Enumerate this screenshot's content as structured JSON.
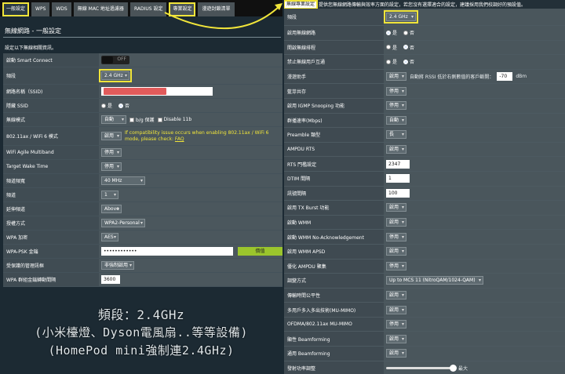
{
  "left": {
    "tabs": [
      "一般設定",
      "WPS",
      "WDS",
      "無線 MAC 地址過濾器",
      "RADIUS 設定",
      "專業設定",
      "漫遊封鎖清單"
    ],
    "title": "無線網路 - 一般設定",
    "description": "設定以下無線相關資訊。",
    "rows": {
      "smart_connect": {
        "label": "啟動 Smart Connect",
        "toggle": "OFF"
      },
      "band": {
        "label": "頻段",
        "value": "2.4 GHz"
      },
      "ssid": {
        "label": "網路名稱（SSID)"
      },
      "hide_ssid": {
        "label": "隱藏 SSID",
        "yes": "是",
        "no": "否"
      },
      "wireless_mode": {
        "label": "無線模式",
        "value": "自動",
        "bg_protect": "b/g 保護",
        "disable11b": "Disable 11b"
      },
      "ax_mode": {
        "label": "802.11ax / WiFi 6 模式",
        "value": "啟用",
        "warn": "If compatibility issue occurs when enabling 802.11ax / WiFi 6 mode, please check:",
        "faq": "FAQ"
      },
      "multiband": {
        "label": "WiFi Agile Multiband",
        "value": "停用"
      },
      "twt": {
        "label": "Target Wake Time",
        "value": "停用"
      },
      "bandwidth": {
        "label": "頻道頻寬",
        "value": "40 MHz"
      },
      "channel": {
        "label": "頻道",
        "value": "1"
      },
      "ext_channel": {
        "label": "延伸頻道",
        "value": "Above"
      },
      "auth": {
        "label": "授權方式",
        "value": "WPA2-Personal"
      },
      "wpa_enc": {
        "label": "WPA 加密",
        "value": "AES"
      },
      "psk": {
        "label": "WPA-PSK 金鑰",
        "value": "••••••••••••",
        "show": "價值"
      },
      "pmf": {
        "label": "受保護的管理訊框",
        "value": "非強制啟用"
      },
      "rekey": {
        "label": "WPA 群組金鑰轉動間隔",
        "value": "3600"
      }
    },
    "caption": {
      "line1": "頻段：2.4GHz",
      "line2": "(小米檯燈、Dyson電風扇..等等設備)",
      "line3": "(HomePod mini強制連2.4GHz)"
    }
  },
  "right": {
    "header_tab": "無線專業設定",
    "header_desc": "提供您無線網路傳輸與效率方面的設定，若您沒有選擇適合的設定，建議採用我們校調好的預設值。",
    "rows": [
      {
        "label": "頻段",
        "type": "select",
        "value": "2.4 GHz",
        "hl": true
      },
      {
        "label": "啟用無線網路",
        "type": "radio",
        "yes": "是",
        "no": "否",
        "on": "yes"
      },
      {
        "label": "開啟無線排程",
        "type": "radio",
        "yes": "是",
        "no": "否",
        "on": "no"
      },
      {
        "label": "禁止無線用戶互通",
        "type": "radio",
        "yes": "是",
        "no": "否",
        "on": "no"
      },
      {
        "label": "漫遊助手",
        "type": "roam",
        "value": "啟用",
        "text": "自動將 RSSI 低於右側數值的客戶斷開：",
        "rssi": "-70",
        "unit": "dBm"
      },
      {
        "label": "藍芽共存",
        "type": "select",
        "value": "停用"
      },
      {
        "label": "啟用 IGMP Snooping 功能",
        "type": "select",
        "value": "停用"
      },
      {
        "label": "群播速率(Mbps)",
        "type": "select",
        "value": "自動"
      },
      {
        "label": "Preamble 類型",
        "type": "select",
        "value": "長"
      },
      {
        "label": "AMPDU RTS",
        "type": "select",
        "value": "啟用"
      },
      {
        "label": "RTS 門檻設定",
        "type": "text",
        "value": "2347"
      },
      {
        "label": "DTIM 間隔",
        "type": "text",
        "value": "1"
      },
      {
        "label": "訊號間隔",
        "type": "text",
        "value": "100"
      },
      {
        "label": "啟用 TX Burst 功能",
        "type": "select",
        "value": "啟用"
      },
      {
        "label": "啟動 WMM",
        "type": "select",
        "value": "啟用"
      },
      {
        "label": "啟動 WMM No-Acknowledgement",
        "type": "select",
        "value": "停用"
      },
      {
        "label": "啟用 WMM APSD",
        "type": "select",
        "value": "啟用"
      },
      {
        "label": "優化 AMPDU 聚集",
        "type": "select",
        "value": "停用"
      },
      {
        "label": "調變方式",
        "type": "select",
        "value": "Up to MCS 11 (NitroQAM/1024-QAM)"
      },
      {
        "label": "傳輸時間公平性",
        "type": "select",
        "value": "啟用"
      },
      {
        "label": "多用戶多入多出技術(MU-MIMO)",
        "type": "select",
        "value": "啟用"
      },
      {
        "label": "OFDMA/802.11ax MU-MIMO",
        "type": "select",
        "value": "停用"
      },
      {
        "label": "顯性 Beamforming",
        "type": "select",
        "value": "啟用"
      },
      {
        "label": "通用 Beamforming",
        "type": "select",
        "value": "啟用"
      },
      {
        "label": "發射功率調整",
        "type": "slider",
        "value": "最大",
        "level": 1.0
      }
    ]
  },
  "colors": {
    "highlight": "#f1e53a",
    "button_green": "#9bc52c",
    "radio_on": "#3179f5"
  }
}
